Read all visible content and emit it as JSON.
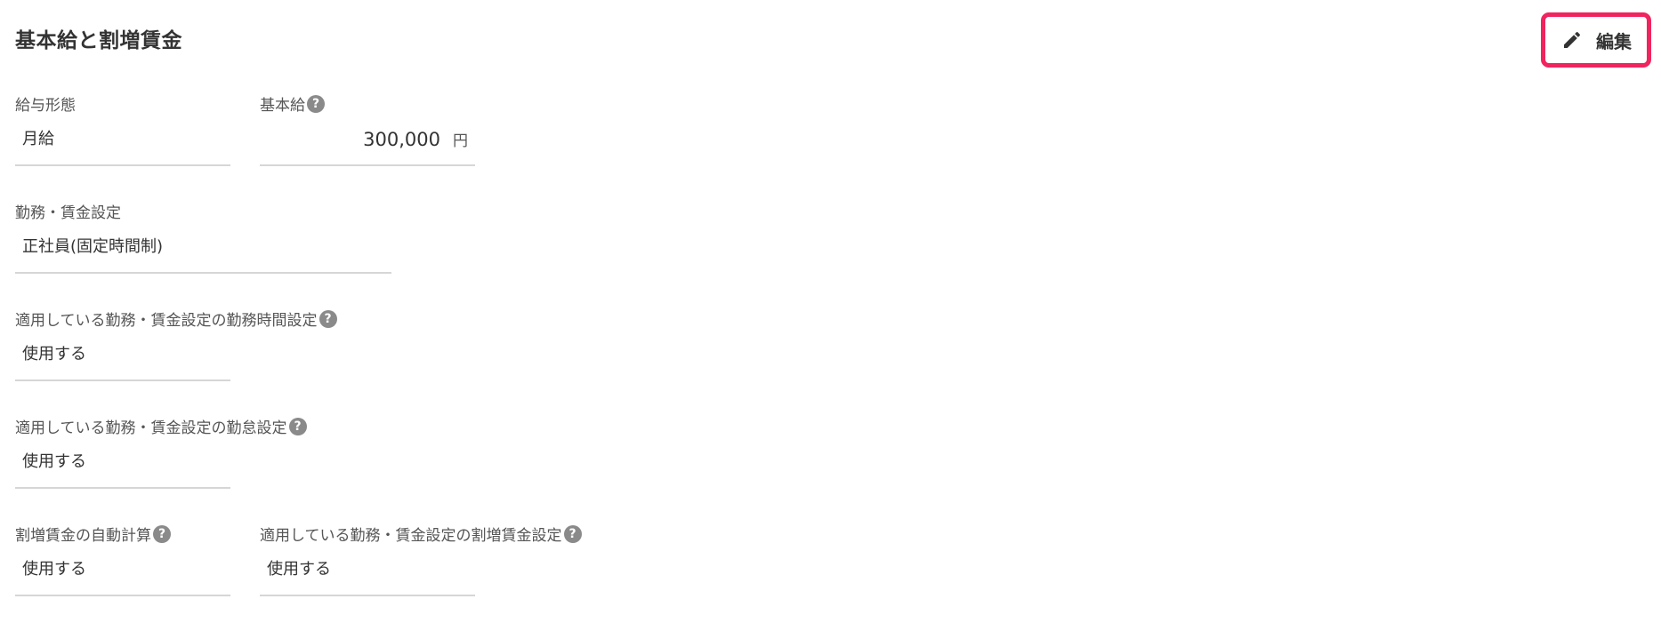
{
  "section": {
    "title": "基本給と割増賃金",
    "edit_label": "編集"
  },
  "fields": {
    "pay_type": {
      "label": "給与形態",
      "value": "月給"
    },
    "base_pay": {
      "label": "基本給",
      "value": "300,000",
      "unit": "円"
    },
    "work_wage_setting": {
      "label": "勤務・賃金設定",
      "value": "正社員(固定時間制)"
    },
    "applied_work_hours": {
      "label": "適用している勤務・賃金設定の勤務時間設定",
      "value": "使用する"
    },
    "applied_attendance": {
      "label": "適用している勤務・賃金設定の勤怠設定",
      "value": "使用する"
    },
    "overtime_auto_calc": {
      "label": "割増賃金の自動計算",
      "value": "使用する"
    },
    "applied_overtime": {
      "label": "適用している勤務・賃金設定の割増賃金設定",
      "value": "使用する"
    }
  },
  "icons": {
    "help": "?",
    "edit": "pencil-icon"
  },
  "colors": {
    "highlight": "#f0245f",
    "help_icon": "#8a8a8a",
    "underline": "#d6d6d6"
  }
}
